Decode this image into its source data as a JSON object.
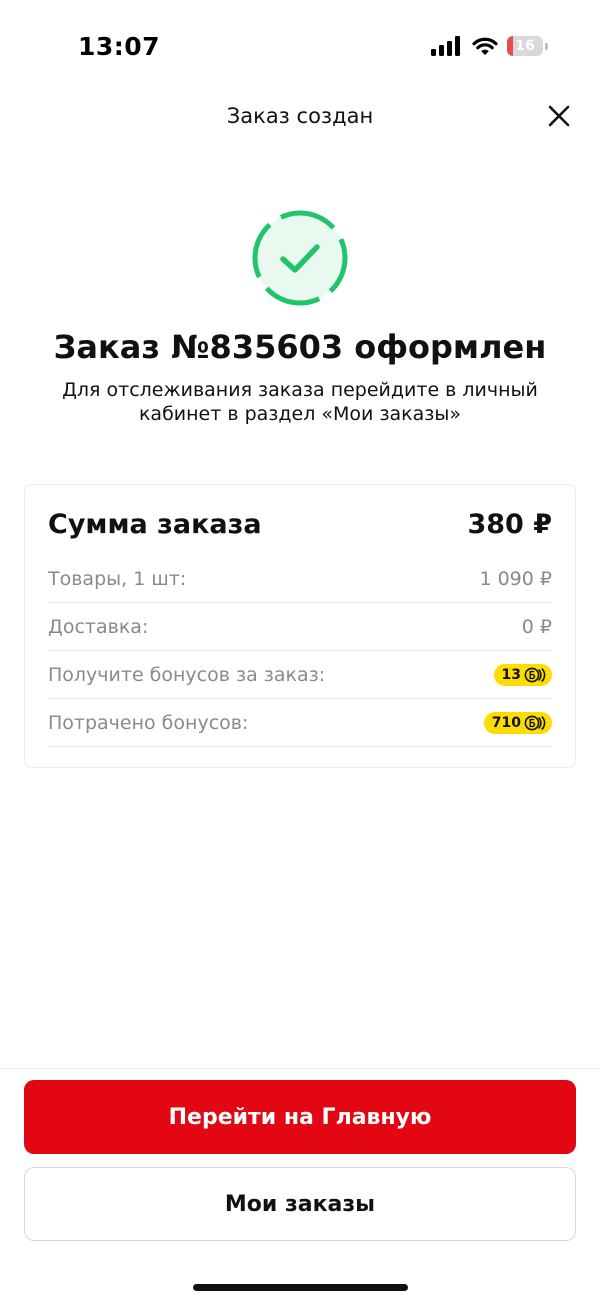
{
  "status_bar": {
    "time": "13:07",
    "battery_level": "16",
    "battery_fraction": 0.16,
    "icons": [
      "cellular-signal-icon",
      "wifi-icon",
      "battery-icon"
    ]
  },
  "header": {
    "title": "Заказ создан",
    "close_icon": "close-icon"
  },
  "success": {
    "icon": "checkmark-circle-icon",
    "color": "#21c46b"
  },
  "order": {
    "title": "Заказ №835603 оформлен",
    "subtitle": "Для отслеживания заказа перейдите в личный кабинет в раздел «Мои заказы»"
  },
  "summary": {
    "label": "Сумма заказа",
    "total": "380 ₽",
    "rows": [
      {
        "label": "Товары, 1 шт:",
        "value": "1 090 ₽"
      },
      {
        "label": "Доставка:",
        "value": "0 ₽"
      },
      {
        "label": "Получите бонусов за заказ:",
        "value": "13"
      },
      {
        "label": "Потрачено бонусов:",
        "value": "710"
      }
    ],
    "bonus_icon": "bonus-coin-icon"
  },
  "actions": {
    "primary_label": "Перейти на Главную",
    "secondary_label": "Мои заказы"
  },
  "colors": {
    "accent": "#e30613",
    "bonus_badge": "#fddc00",
    "success": "#21c46b"
  }
}
